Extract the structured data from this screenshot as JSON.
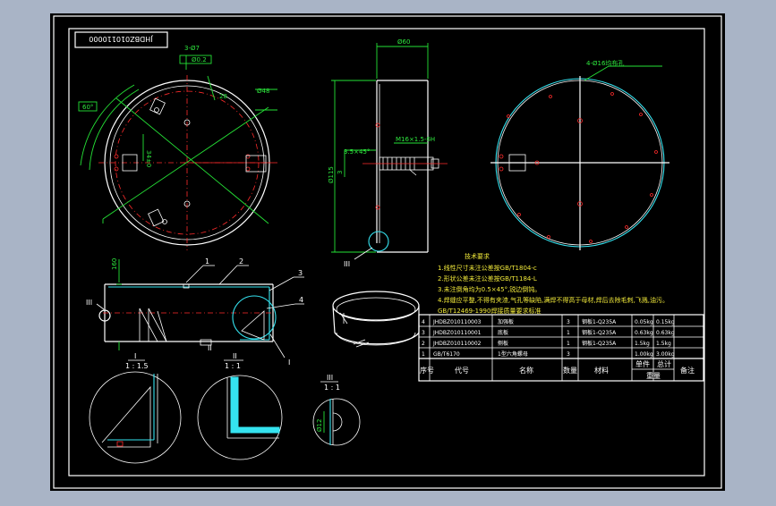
{
  "drawing": {
    "title_code": "JHDBZ010110000",
    "views": {
      "front_view": {
        "dims": [
          "3-Ø7",
          "Ø0.2",
          "34±0",
          "28",
          "Ø48",
          "60°"
        ]
      },
      "side_view": {
        "dims": [
          "Ø60",
          "Ø115",
          "3.5×45°",
          "3",
          "M16×1.5-6H"
        ],
        "detail_ref": "III"
      },
      "top_right_view": {
        "note": "4-Ø16均布孔"
      },
      "section_view": {
        "balloons": [
          "1",
          "2",
          "3",
          "4"
        ],
        "dims": [
          "160"
        ],
        "detail_refs": [
          "III",
          "I"
        ]
      },
      "details": [
        {
          "id": "I",
          "scale": "1 : 1.5"
        },
        {
          "id": "II",
          "scale": "1 : 1"
        },
        {
          "id": "III",
          "scale": "1 : 1",
          "dim": "Ø12"
        }
      ]
    },
    "tech_requirements": {
      "title": "技术要求",
      "items": [
        "1.线性尺寸未注公差按GB/T1804-c",
        "2.形状公差未注公差按GB/T1184-L",
        "3.未注倒角均为0.5×45°,锐边倒钝。",
        "4.焊缝应平整,不得有夹渣,气孔等缺陷,满焊不得高于母材,焊后去除毛刺,飞溅,油污。",
        "GB/T12469-1990焊接质量要求标准"
      ]
    },
    "bom": {
      "rows": [
        {
          "no": "4",
          "code": "JHDBZ010110003",
          "name": "加强板",
          "qty": "3",
          "material": "钢板1-Q235A",
          "unit_mass": "0.05kg",
          "total_mass": "0.15kg",
          "remark": ""
        },
        {
          "no": "3",
          "code": "JHDBZ010110001",
          "name": "底板",
          "qty": "1",
          "material": "钢板1-Q235A",
          "unit_mass": "0.63kg",
          "total_mass": "0.63kg",
          "remark": ""
        },
        {
          "no": "2",
          "code": "JHDBZ010110002",
          "name": "侧板",
          "qty": "1",
          "material": "钢板1-Q235A",
          "unit_mass": "1.5kg",
          "total_mass": "1.5kg",
          "remark": ""
        },
        {
          "no": "1",
          "code": "GB/T6170",
          "name": "1型六角螺母",
          "qty": "3",
          "material": "",
          "unit_mass": "1.00kg",
          "total_mass": "3.00kg",
          "remark": ""
        }
      ],
      "headers": {
        "no": "序号",
        "code": "代号",
        "name": "名称",
        "qty": "数量",
        "material": "材料",
        "unit_mass": "单件",
        "total_mass": "总计",
        "mass_sub": "重量",
        "remark": "备注"
      }
    }
  },
  "colors": {
    "canvas": "#000000",
    "viewport_bg": "#a9b4c6",
    "outline": "#ffffff",
    "part_edge": "#35e3f0",
    "centerline": "#ff2b2b",
    "dimension": "#25e236",
    "note_text": "#f2ea3a"
  }
}
